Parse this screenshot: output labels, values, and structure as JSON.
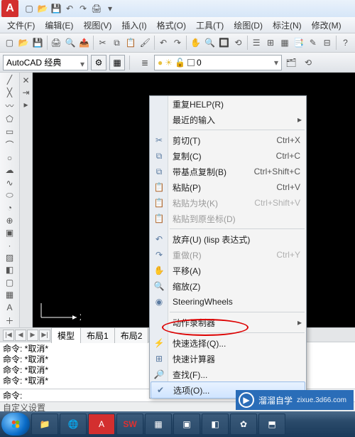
{
  "title_app": "A",
  "menus": [
    "文件(F)",
    "编辑(E)",
    "视图(V)",
    "插入(I)",
    "格式(O)",
    "工具(T)",
    "绘图(D)",
    "标注(N)",
    "修改(M)"
  ],
  "workspace": {
    "current": "AutoCAD 经典"
  },
  "layer": {
    "current": "0"
  },
  "tabs": {
    "nav": [
      "|◀",
      "◀",
      "▶",
      "▶|"
    ],
    "items": [
      "模型",
      "布局1",
      "布局2"
    ]
  },
  "command_history": [
    "命令: *取消*",
    "命令: *取消*",
    "命令: *取消*",
    "命令: *取消*"
  ],
  "command_prompt": "命令:",
  "status_text": "自定义设置",
  "ucs": {
    "x": "X"
  },
  "context_menu": [
    {
      "type": "item",
      "label": "重复HELP(R)"
    },
    {
      "type": "item",
      "label": "最近的输入",
      "submenu": true
    },
    {
      "type": "sep"
    },
    {
      "type": "item",
      "icon": "✂",
      "label": "剪切(T)",
      "shortcut": "Ctrl+X"
    },
    {
      "type": "item",
      "icon": "⧉",
      "label": "复制(C)",
      "shortcut": "Ctrl+C"
    },
    {
      "type": "item",
      "icon": "⧉",
      "label": "带基点复制(B)",
      "shortcut": "Ctrl+Shift+C"
    },
    {
      "type": "item",
      "icon": "📋",
      "label": "粘贴(P)",
      "shortcut": "Ctrl+V"
    },
    {
      "type": "item",
      "icon": "📋",
      "label": "粘贴为块(K)",
      "shortcut": "Ctrl+Shift+V",
      "disabled": true
    },
    {
      "type": "item",
      "icon": "📋",
      "label": "粘贴到原坐标(D)",
      "disabled": true
    },
    {
      "type": "sep"
    },
    {
      "type": "item",
      "icon": "↶",
      "label": "放弃(U) (lisp 表达式)"
    },
    {
      "type": "item",
      "icon": "↷",
      "label": "重做(R)",
      "shortcut": "Ctrl+Y",
      "disabled": true
    },
    {
      "type": "item",
      "icon": "✋",
      "label": "平移(A)"
    },
    {
      "type": "item",
      "icon": "🔍",
      "label": "缩放(Z)"
    },
    {
      "type": "item",
      "icon": "◉",
      "label": "SteeringWheels"
    },
    {
      "type": "sep"
    },
    {
      "type": "item",
      "label": "动作录制器",
      "submenu": true
    },
    {
      "type": "sep"
    },
    {
      "type": "item",
      "icon": "⚡",
      "label": "快速选择(Q)..."
    },
    {
      "type": "item",
      "icon": "⊞",
      "label": "快速计算器"
    },
    {
      "type": "item",
      "icon": "🔎",
      "label": "查找(F)..."
    },
    {
      "type": "item",
      "icon": "✔",
      "label": "选项(O)...",
      "hover": true
    }
  ],
  "watermark": {
    "site": "zixue.3d66.com",
    "brand": "溜溜自学"
  }
}
